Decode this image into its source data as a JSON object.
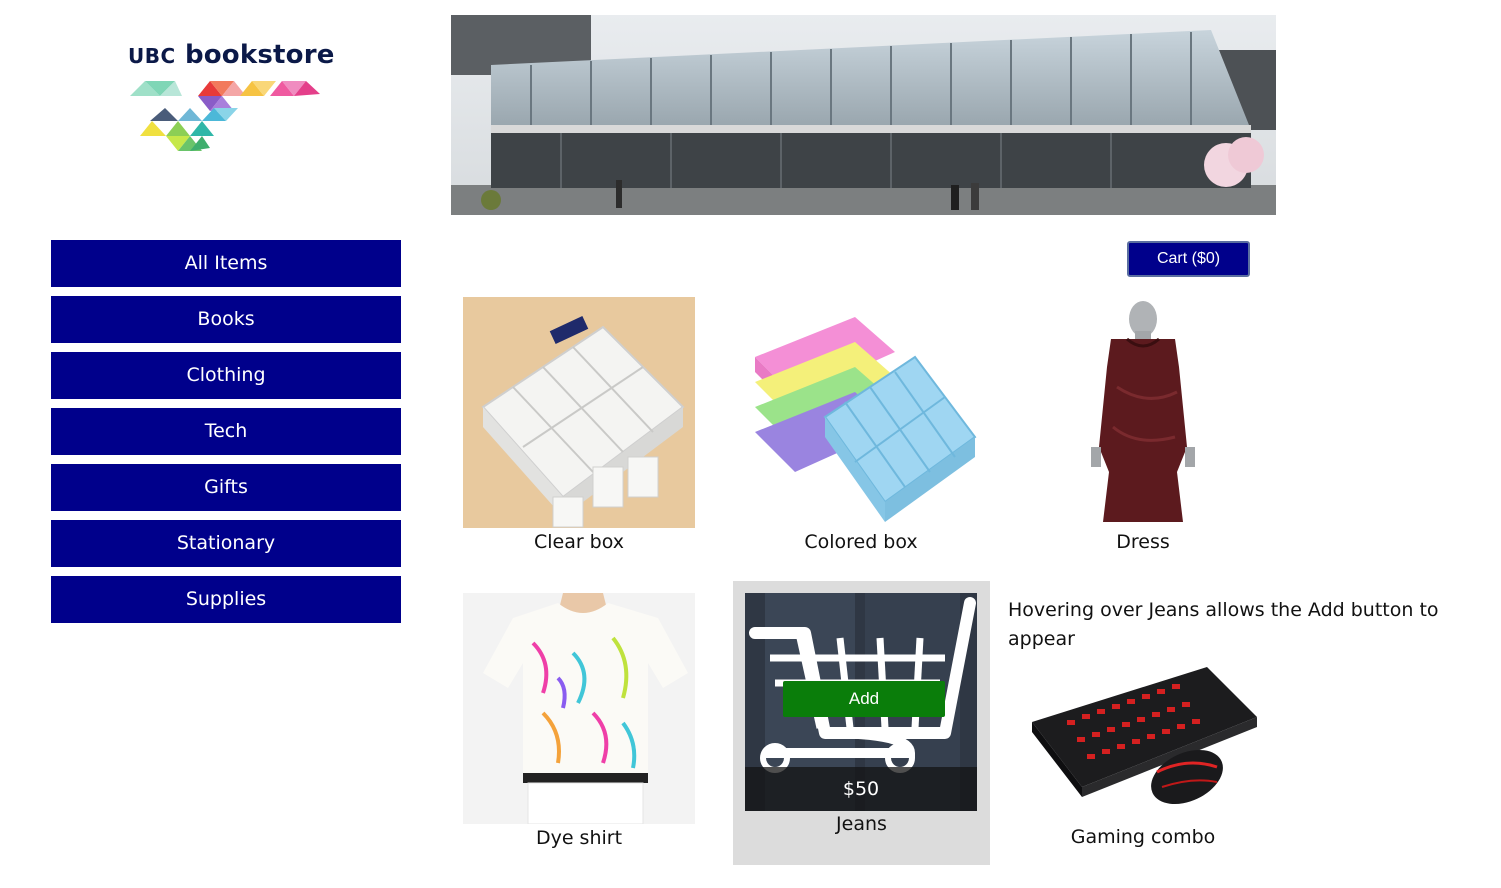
{
  "logo": {
    "ubc": "UBC",
    "text": "bookstore"
  },
  "nav": {
    "items": [
      {
        "label": "All Items"
      },
      {
        "label": "Books"
      },
      {
        "label": "Clothing"
      },
      {
        "label": "Tech"
      },
      {
        "label": "Gifts"
      },
      {
        "label": "Stationary"
      },
      {
        "label": "Supplies"
      }
    ]
  },
  "cart": {
    "label": "Cart ($0)"
  },
  "products": [
    {
      "name": "Clear box"
    },
    {
      "name": "Colored box"
    },
    {
      "name": "Dress"
    },
    {
      "name": "Dye shirt"
    },
    {
      "name": "Jeans",
      "price": "$50",
      "add_label": "Add"
    },
    {
      "name": "Gaming combo"
    }
  ],
  "note": {
    "text": "Hovering over Jeans allows the Add button to appear"
  },
  "colors": {
    "nav_bg": "#00008b",
    "add_bg": "#0a7d0a",
    "logo_text": "#0b1948"
  }
}
